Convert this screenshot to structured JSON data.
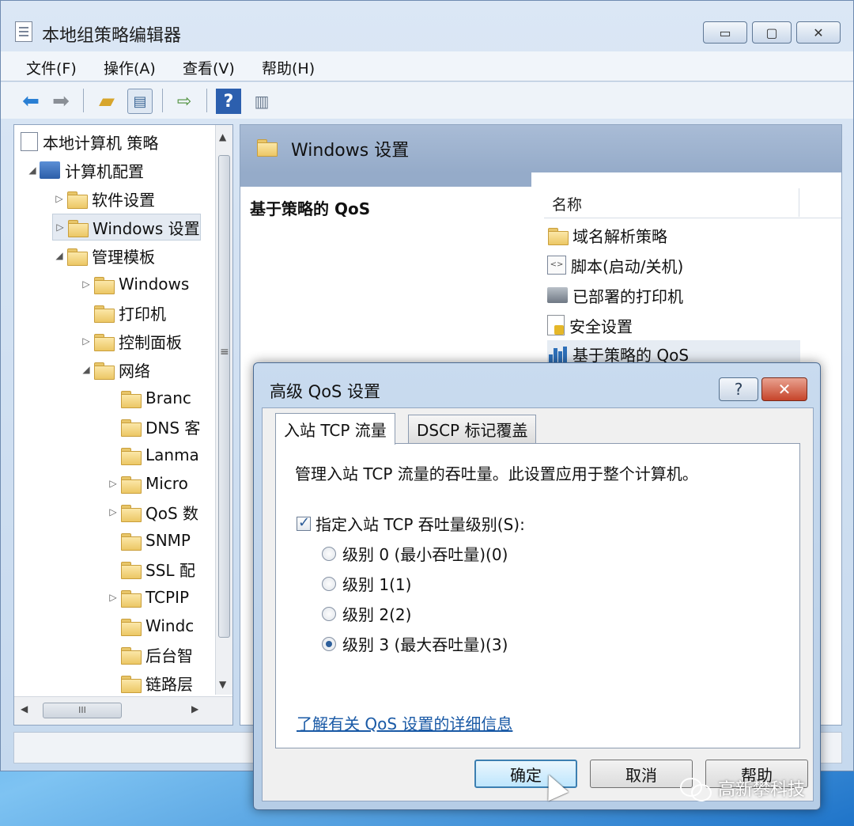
{
  "window": {
    "title": "本地组策略编辑器",
    "min": "▭",
    "max": "▢",
    "close": "✕"
  },
  "menu": [
    "文件(F)",
    "操作(A)",
    "查看(V)",
    "帮助(H)"
  ],
  "toolbar": {
    "icons": [
      "back-arrow-icon",
      "forward-arrow-icon",
      "up-folder-icon",
      "show-hide-tree-icon",
      "export-list-icon",
      "help-icon",
      "action-pane-icon"
    ],
    "help_glyph": "?"
  },
  "tree": {
    "root": "本地计算机 策略",
    "items": [
      {
        "label": "计算机配置",
        "arrow": "◢"
      },
      {
        "label": "软件设置",
        "arrow": "▷"
      },
      {
        "label": "Windows 设置",
        "arrow": "▷"
      },
      {
        "label": "管理模板",
        "arrow": "◢"
      },
      {
        "label": "Windows",
        "arrow": "▷"
      },
      {
        "label": "打印机",
        "arrow": ""
      },
      {
        "label": "控制面板",
        "arrow": "▷"
      },
      {
        "label": "网络",
        "arrow": "◢"
      },
      {
        "label": "Branc",
        "arrow": ""
      },
      {
        "label": "DNS 客",
        "arrow": ""
      },
      {
        "label": "Lanma",
        "arrow": ""
      },
      {
        "label": "Micro",
        "arrow": "▷"
      },
      {
        "label": "QoS 数",
        "arrow": "▷"
      },
      {
        "label": "SNMP",
        "arrow": ""
      },
      {
        "label": "SSL 配",
        "arrow": ""
      },
      {
        "label": "TCPIP",
        "arrow": "▷"
      },
      {
        "label": "Windc",
        "arrow": ""
      },
      {
        "label": "后台智",
        "arrow": ""
      },
      {
        "label": "链路层",
        "arrow": ""
      }
    ],
    "scroll_up": "▲",
    "scroll_down": "▼",
    "scroll_left": "◀",
    "scroll_right": "▶",
    "scroll_grip": "≡",
    "hscroll_grip": "III"
  },
  "detail": {
    "title": "Windows 设置",
    "policy_name": "基于策略的 QoS",
    "column": "名称",
    "items": [
      {
        "label": "域名解析策略",
        "icon": "folder-icon"
      },
      {
        "label": "脚本(启动/关机)",
        "icon": "script-icon"
      },
      {
        "label": "已部署的打印机",
        "icon": "printer-icon"
      },
      {
        "label": "安全设置",
        "icon": "security-icon"
      },
      {
        "label": "基于策略的 QoS",
        "icon": "qos-chart-icon"
      }
    ]
  },
  "dialog": {
    "title": "高级 QoS 设置",
    "help": "?",
    "close": "✕",
    "tabs": [
      "入站 TCP 流量",
      "DSCP 标记覆盖"
    ],
    "description": "管理入站 TCP 流量的吞吐量。此设置应用于整个计算机。",
    "checkbox_label": "指定入站 TCP 吞吐量级别(S):",
    "checkbox_checked": true,
    "radios": [
      {
        "label": "级别 0 (最小吞吐量)(0)",
        "checked": false
      },
      {
        "label": "级别 1(1)",
        "checked": false
      },
      {
        "label": "级别 2(2)",
        "checked": false
      },
      {
        "label": "级别 3 (最大吞吐量)(3)",
        "checked": true
      }
    ],
    "learn_link": "了解有关 QoS 设置的详细信息",
    "buttons": {
      "ok": "确定",
      "cancel": "取消",
      "help": "帮助"
    }
  },
  "watermark": "高新攀科技"
}
